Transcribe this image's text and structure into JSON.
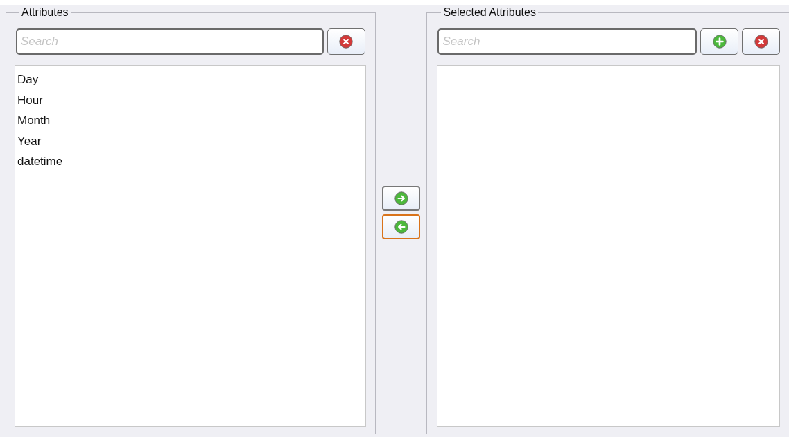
{
  "attributes_panel": {
    "legend": "Attributes",
    "search": {
      "placeholder": "Search"
    },
    "buttons": [
      {
        "kind": "clear"
      }
    ],
    "items": [
      {
        "label": "Day"
      },
      {
        "label": "Hour"
      },
      {
        "label": "Month"
      },
      {
        "label": "Year"
      },
      {
        "label": "datetime"
      }
    ]
  },
  "move_buttons": [
    {
      "kind": "right",
      "focused": false
    },
    {
      "kind": "left",
      "focused": true
    }
  ],
  "selected_panel": {
    "legend": "Selected Attributes",
    "search": {
      "placeholder": "Search"
    },
    "buttons": [
      {
        "kind": "add"
      },
      {
        "kind": "clear"
      }
    ]
  }
}
